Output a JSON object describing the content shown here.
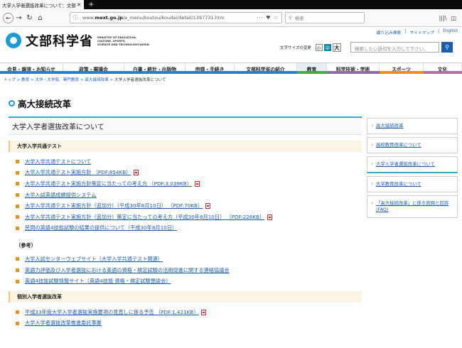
{
  "browser": {
    "tab_title": "大学入学者選抜改革について：文部",
    "tab_close": "✕",
    "new_tab": "+",
    "url_prefix": "www.",
    "url_domain": "mext.go.jp",
    "url_path": "/a_menu/koutou/koudai/detail/1397731.htm",
    "url_tools": "··· ♥ ☆",
    "search_placeholder": "検索"
  },
  "site": {
    "logo_text": "文部科学省",
    "logo_en": [
      "MINISTRY OF EDUCATION,",
      "CULTURE, SPORTS,",
      "SCIENCE AND TECHNOLOGY-JAPAN"
    ],
    "toplinks": [
      "綴り込み検索",
      "サイトマップ",
      "English"
    ],
    "fontsize_label": "文字サイズの変更",
    "fontsize_small": "小",
    "fontsize_medium": "中",
    "fontsize_large": "大",
    "search_placeholder": "検索したい語句を入力して下さい。"
  },
  "gnav": [
    {
      "label": "会見・報道・お知らせ",
      "color": "#2b7fc6"
    },
    {
      "label": "政策・審議会",
      "color": "#2b7fc6"
    },
    {
      "label": "白書・統計・出版物",
      "color": "#2b7fc6"
    },
    {
      "label": "申請・手続き",
      "color": "#2b7fc6"
    },
    {
      "label": "文部科学省の紹介",
      "color": "#2b7fc6"
    },
    {
      "label": "教育",
      "color": "#49a844"
    },
    {
      "label": "科学技術・学術",
      "color": "#8c6ba8"
    },
    {
      "label": "スポーツ",
      "color": "#e98f1b"
    },
    {
      "label": "文化",
      "color": "#b06f9c"
    }
  ],
  "breadcrumb": {
    "items": [
      "トップ",
      "教育",
      "大学・大学院、専門教育",
      "高大接続改革"
    ],
    "current": "大学入学者選抜改革について"
  },
  "page_title": "高大接続改革",
  "main": {
    "section_title": "大学入学者選抜改革について",
    "sub1": "大学入学共通テスト",
    "links1": [
      {
        "text": "大学入学共通テストについて",
        "pdf": false
      },
      {
        "text": "大学入学共通テスト実施方針 （PDF:854KB）",
        "pdf": true
      },
      {
        "text": "大学入学共通テスト実施方針策定に当たっての考え方 （PDF:3,039KB）",
        "pdf": true
      },
      {
        "text": "大学入試英語成績提供システム",
        "pdf": false
      },
      {
        "text": "大学入学共通テスト実施方針（追加分）（平成30年8月10日） （PDF:70KB）",
        "pdf": true
      },
      {
        "text": "大学入学共通テスト実施方針（追加分）策定に当たっての考え方（平成30年8月10日） （PDF:226KB）",
        "pdf": true
      },
      {
        "text": "民間の英語4技能試験の結果の提供について（平成30年8月10日）",
        "pdf": false
      }
    ],
    "ref_head": "（参考）",
    "links2": [
      {
        "text": "大学入試センターウェブサイト（大学入学共通テスト関連）",
        "pdf": false
      },
      {
        "text": "英語力評価及び入学者選抜における英語の資格・検定試験の活用促進に関する連絡協議会",
        "pdf": false
      },
      {
        "text": "英語4技能試験情報サイト（英語4技能 資格・検定試験懇談会）",
        "pdf": false
      }
    ],
    "sub2": "個別入学者選抜改革",
    "links3": [
      {
        "text": "平成33年度大学入学者選抜実施要項の見直しに係る予告 （PDF:1,421KB）",
        "pdf": true
      },
      {
        "text": "大学入学者選抜改革推進委託事業",
        "pdf": false
      }
    ]
  },
  "side": [
    {
      "label": "高大接続改革",
      "current": false
    },
    {
      "label": "高校教育改革について",
      "current": false
    },
    {
      "label": "大学入学者選抜改革について",
      "current": true
    },
    {
      "label": "大学教育改革について",
      "current": false
    },
    {
      "label": "「高大接続改革」に係る質問と回答(FAQ)",
      "current": false
    }
  ]
}
